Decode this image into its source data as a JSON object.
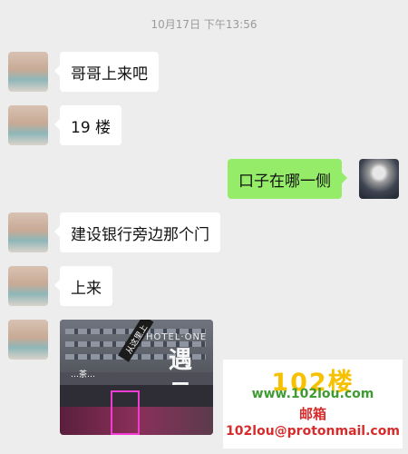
{
  "timestamp": "10月17日 下午13:56",
  "messages": [
    {
      "side": "in",
      "text": "哥哥上来吧"
    },
    {
      "side": "in",
      "text": "19 楼"
    },
    {
      "side": "out",
      "text": "口子在哪一侧"
    },
    {
      "side": "in",
      "text": "建设银行旁边那个门"
    },
    {
      "side": "in",
      "text": "上来"
    }
  ],
  "photo": {
    "sign_text": "HOTEL·ONE",
    "shop_text": "…茶…",
    "arrow_text": "从这里上",
    "big_glyphs": "遇见"
  },
  "watermark": {
    "line1": "102楼",
    "line2": "www.102lou.com",
    "line3": "邮箱",
    "line4": "102lou@protonmail.com"
  },
  "icons": {
    "incoming_avatar": "avatar-girl",
    "outgoing_avatar": "avatar-astronaut"
  }
}
